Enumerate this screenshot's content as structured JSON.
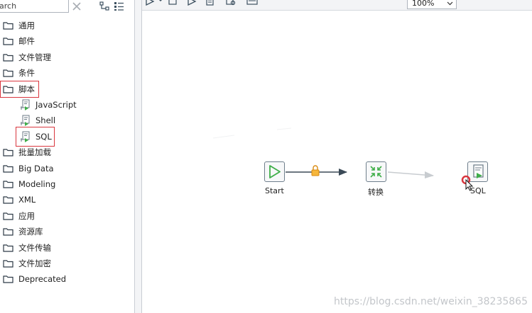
{
  "search": {
    "value": "arch"
  },
  "tree": [
    {
      "label": "通用"
    },
    {
      "label": "邮件"
    },
    {
      "label": "文件管理"
    },
    {
      "label": "条件"
    },
    {
      "label": "脚本",
      "children": [
        {
          "label": "JavaScript"
        },
        {
          "label": "Shell"
        },
        {
          "label": "SQL"
        }
      ]
    },
    {
      "label": "批量加载"
    },
    {
      "label": "Big Data"
    },
    {
      "label": "Modeling"
    },
    {
      "label": "XML"
    },
    {
      "label": "应用"
    },
    {
      "label": "资源库"
    },
    {
      "label": "文件传输"
    },
    {
      "label": "文件加密"
    },
    {
      "label": "Deprecated"
    }
  ],
  "toolbar": {
    "zoom": "100%"
  },
  "canvas": {
    "nodes": [
      {
        "label": "Start"
      },
      {
        "label": "转换"
      },
      {
        "label": "SQL"
      }
    ]
  },
  "watermark": "https://blog.csdn.net/weixin_38235865",
  "colors": {
    "highlight": "#d9363e",
    "start_icon": "#3fae49",
    "hop_lock": "#f0a020",
    "hop_arrow": "#3b4a57",
    "node_border": "#6f7f8c"
  },
  "icons": {
    "folder": "folder-icon",
    "script_entry": "script-icon",
    "clear": "clear-icon",
    "expand": "expand-all-icon",
    "collapse": "collapse-all-icon"
  }
}
